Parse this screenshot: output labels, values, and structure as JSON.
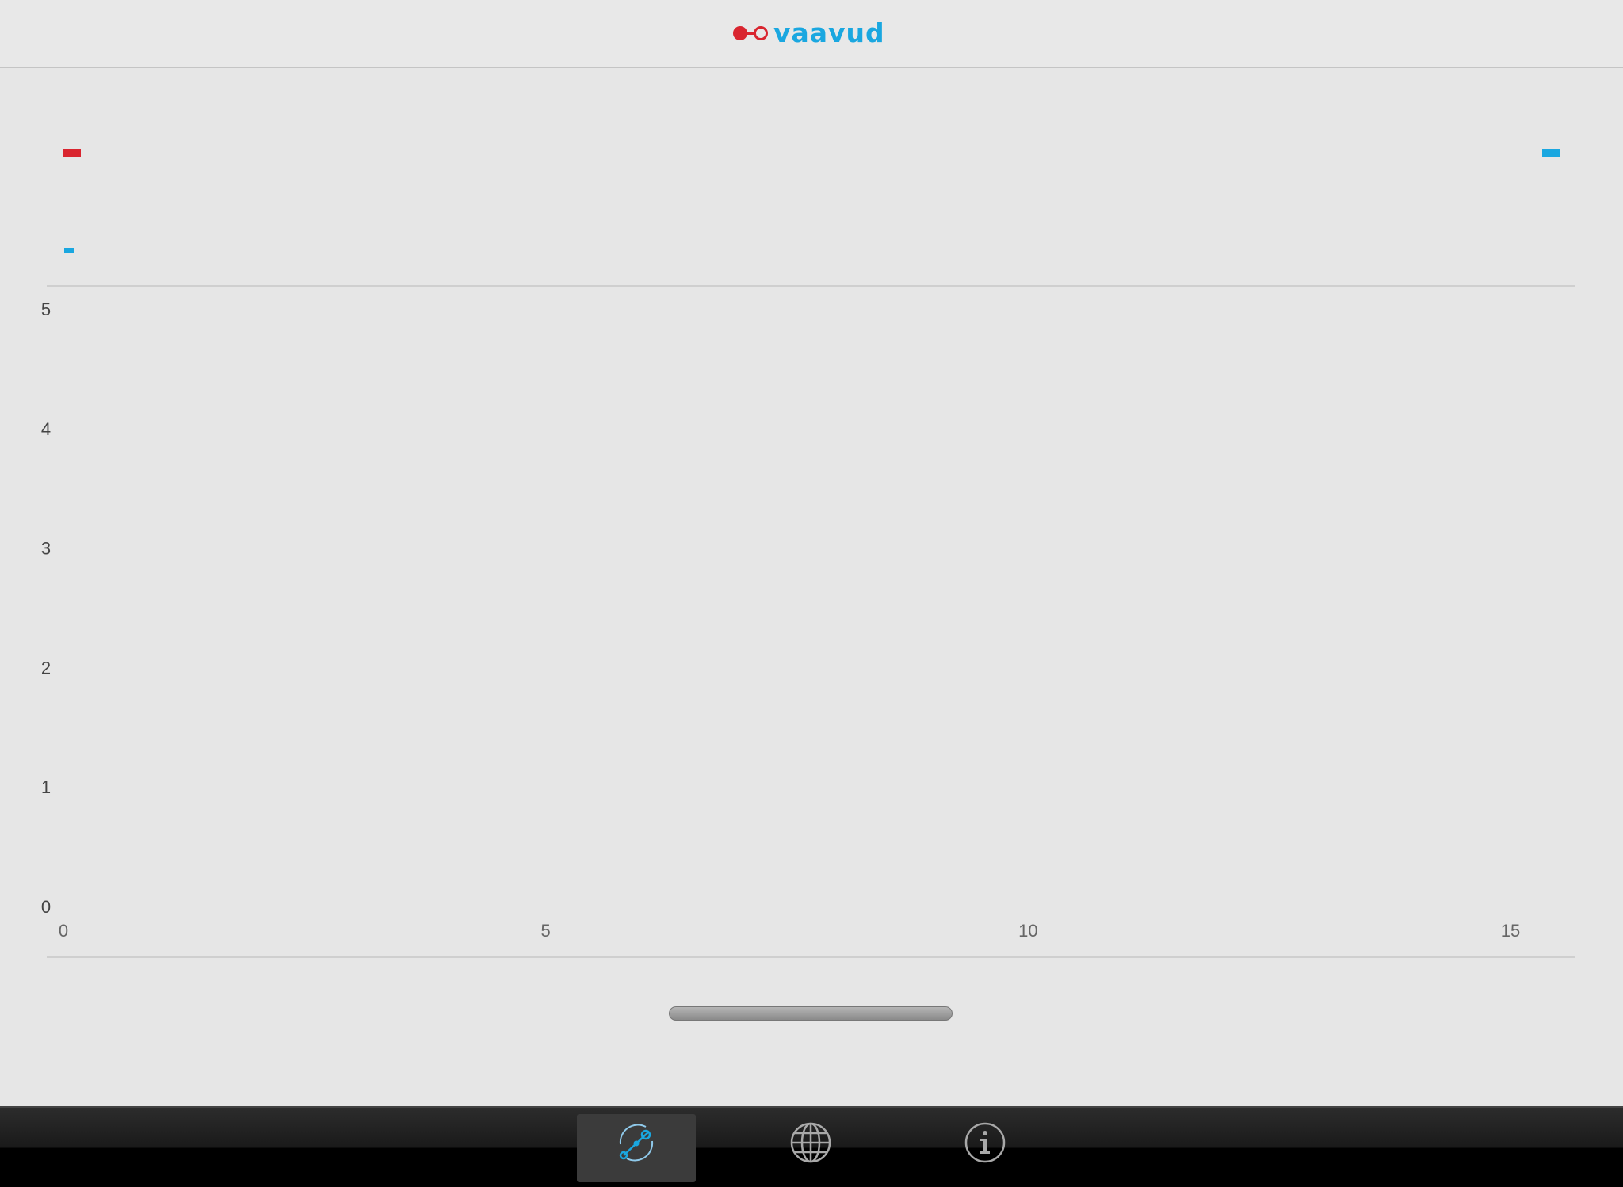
{
  "header": {
    "logo_text": "vaavud",
    "logo_colors": {
      "mark": "#d9252f",
      "text": "#1aa7e0"
    }
  },
  "indicators": {
    "left_top_color": "#d9252f",
    "left_bottom_color": "#1aa7e0",
    "right_top_color": "#1aa7e0"
  },
  "chart_data": {
    "type": "line",
    "title": "",
    "xlabel": "",
    "ylabel": "",
    "x_ticks": [
      "0",
      "5",
      "10",
      "15"
    ],
    "y_ticks": [
      "0",
      "1",
      "2",
      "3",
      "4",
      "5"
    ],
    "xlim": [
      0,
      15
    ],
    "ylim": [
      0,
      5
    ],
    "series": [],
    "grid": false
  },
  "scrollbar": {
    "icon": "scroll-handle"
  },
  "tabs": [
    {
      "name": "measure",
      "icon": "anemometer-icon",
      "active": true
    },
    {
      "name": "map",
      "icon": "globe-icon",
      "active": false
    },
    {
      "name": "info",
      "icon": "info-icon",
      "active": false
    }
  ]
}
